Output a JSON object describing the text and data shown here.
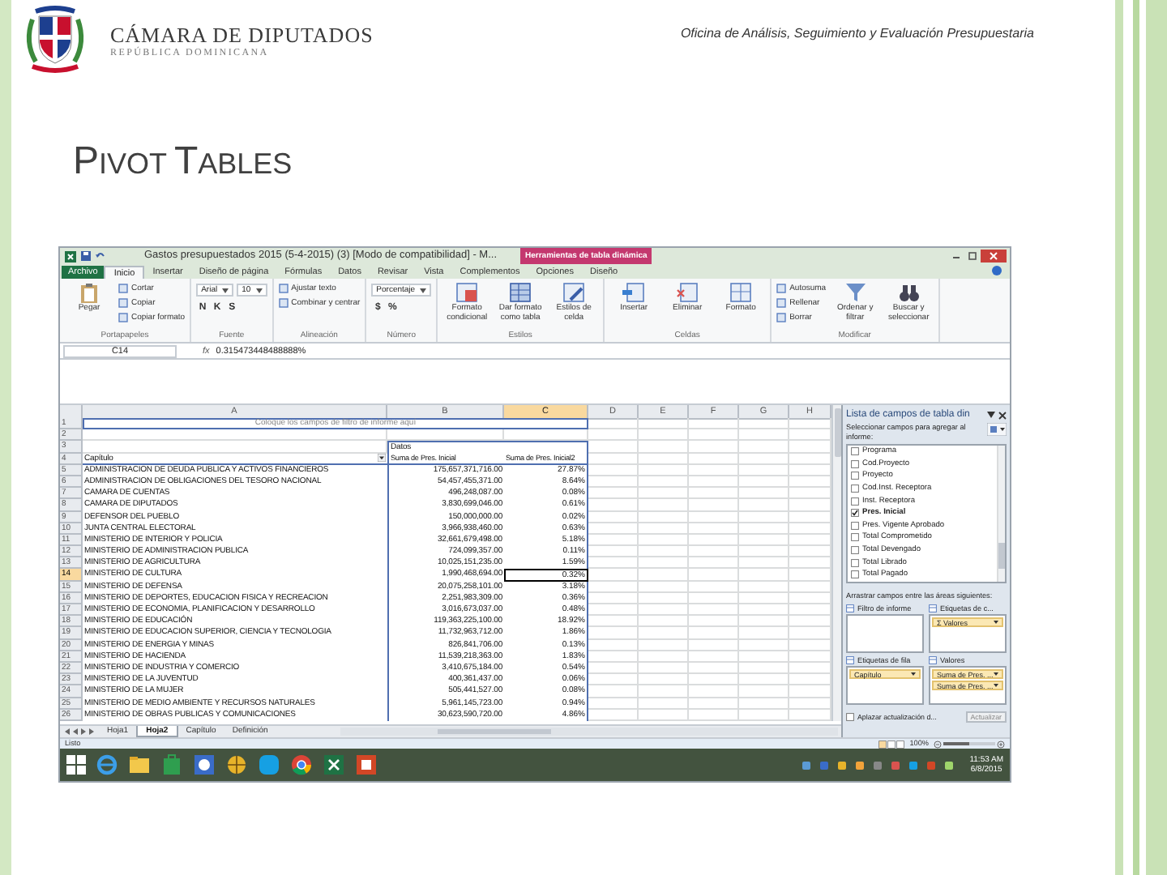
{
  "header": {
    "org_name": "CÁMARA DE DIPUTADOS",
    "org_subtitle": "REPÚBLICA DOMINICANA",
    "office": "Oficina de Análisis, Seguimiento y Evaluación Presupuestaria"
  },
  "title": "PIVOT TABLES",
  "excel": {
    "window_title": "Gastos presupuestados 2015 (5-4-2015) (3)  [Modo de compatibilidad] - M...",
    "contextual_group": "Herramientas de tabla dinámica",
    "ribbon_tabs": [
      {
        "label": "Archivo",
        "kind": "file",
        "selected": false
      },
      {
        "label": "Inicio",
        "kind": "tab",
        "selected": true
      },
      {
        "label": "Insertar",
        "kind": "tab",
        "selected": false
      },
      {
        "label": "Diseño de página",
        "kind": "tab",
        "selected": false
      },
      {
        "label": "Fórmulas",
        "kind": "tab",
        "selected": false
      },
      {
        "label": "Datos",
        "kind": "tab",
        "selected": false
      },
      {
        "label": "Revisar",
        "kind": "tab",
        "selected": false
      },
      {
        "label": "Vista",
        "kind": "tab",
        "selected": false
      },
      {
        "label": "Complementos",
        "kind": "tab",
        "selected": false
      },
      {
        "label": "Opciones",
        "kind": "tab",
        "selected": false
      },
      {
        "label": "Diseño",
        "kind": "tab",
        "selected": false
      }
    ],
    "ribbon_groups": [
      {
        "label": "Portapapeles",
        "items": [
          {
            "kind": "large",
            "label": "Pegar"
          },
          {
            "kind": "small",
            "label": "Cortar"
          },
          {
            "kind": "small",
            "label": "Copiar"
          },
          {
            "kind": "small",
            "label": "Copiar formato"
          }
        ]
      },
      {
        "label": "Fuente",
        "items": [
          {
            "kind": "field",
            "label": "Arial"
          },
          {
            "kind": "field",
            "label": "10"
          },
          {
            "kind": "glyph",
            "label": "N"
          },
          {
            "kind": "glyph",
            "label": "K"
          },
          {
            "kind": "glyph",
            "label": "S"
          }
        ]
      },
      {
        "label": "Alineación",
        "items": [
          {
            "kind": "small",
            "label": "Ajustar texto"
          },
          {
            "kind": "small",
            "label": "Combinar y centrar"
          }
        ]
      },
      {
        "label": "Número",
        "items": [
          {
            "kind": "field",
            "label": "Porcentaje"
          },
          {
            "kind": "glyph",
            "label": "$"
          },
          {
            "kind": "glyph",
            "label": "%"
          }
        ]
      },
      {
        "label": "Estilos",
        "items": [
          {
            "kind": "large",
            "label": "Formato condicional"
          },
          {
            "kind": "large",
            "label": "Dar formato como tabla"
          },
          {
            "kind": "large",
            "label": "Estilos de celda"
          }
        ]
      },
      {
        "label": "Celdas",
        "items": [
          {
            "kind": "large",
            "label": "Insertar"
          },
          {
            "kind": "large",
            "label": "Eliminar"
          },
          {
            "kind": "large",
            "label": "Formato"
          }
        ]
      },
      {
        "label": "Modificar",
        "items": [
          {
            "kind": "small",
            "label": "Autosuma"
          },
          {
            "kind": "small",
            "label": "Rellenar"
          },
          {
            "kind": "small",
            "label": "Borrar"
          },
          {
            "kind": "large",
            "label": "Ordenar y filtrar"
          },
          {
            "kind": "large",
            "label": "Buscar y seleccionar"
          }
        ]
      }
    ],
    "name_box": "C14",
    "function_label": "fx",
    "formula": "0.315473448488888%",
    "columns": [
      {
        "label": "A",
        "selected": false
      },
      {
        "label": "B",
        "selected": false
      },
      {
        "label": "C",
        "selected": true
      },
      {
        "label": "D",
        "selected": false
      },
      {
        "label": "E",
        "selected": false
      },
      {
        "label": "F",
        "selected": false
      },
      {
        "label": "G",
        "selected": false
      },
      {
        "label": "H",
        "selected": false
      }
    ],
    "rows": [
      {
        "number": "1",
        "kind": "filter",
        "text": "Coloque los campos de filtro de informe aquí",
        "selected": false
      },
      {
        "number": "2",
        "kind": "blank",
        "selected": false
      },
      {
        "number": "3",
        "kind": "caption",
        "text": "Datos",
        "selected": false
      },
      {
        "number": "4",
        "kind": "header",
        "label": "Capítulo",
        "values": [
          "Suma de Pres. Inicial",
          "Suma de Pres. Inicial2"
        ],
        "selected": false
      },
      {
        "number": "5",
        "kind": "data",
        "label": "ADMINISTRACION DE DEUDA PUBLICA Y ACTIVOS FINANCIEROS",
        "amount": "175,657,371,716.00",
        "share": "27.87%",
        "selected": false
      },
      {
        "number": "6",
        "kind": "data",
        "label": "ADMINISTRACION DE OBLIGACIONES DEL TESORO NACIONAL",
        "amount": "54,457,455,371.00",
        "share": "8.64%",
        "selected": false
      },
      {
        "number": "7",
        "kind": "data",
        "label": "CAMARA DE CUENTAS",
        "amount": "496,248,087.00",
        "share": "0.08%",
        "selected": false
      },
      {
        "number": "8",
        "kind": "data",
        "label": "CAMARA DE DIPUTADOS",
        "amount": "3,830,699,046.00",
        "share": "0.61%",
        "selected": false
      },
      {
        "number": "9",
        "kind": "data",
        "label": "DEFENSOR DEL PUEBLO",
        "amount": "150,000,000.00",
        "share": "0.02%",
        "selected": false
      },
      {
        "number": "10",
        "kind": "data",
        "label": "JUNTA CENTRAL ELECTORAL",
        "amount": "3,966,938,460.00",
        "share": "0.63%",
        "selected": false
      },
      {
        "number": "11",
        "kind": "data",
        "label": "MINISTERIO DE INTERIOR Y POLICIA",
        "amount": "32,661,679,498.00",
        "share": "5.18%",
        "selected": false
      },
      {
        "number": "12",
        "kind": "data",
        "label": "MINISTERIO DE ADMINISTRACION PUBLICA",
        "amount": "724,099,357.00",
        "share": "0.11%",
        "selected": false
      },
      {
        "number": "13",
        "kind": "data",
        "label": "MINISTERIO DE AGRICULTURA",
        "amount": "10,025,151,235.00",
        "share": "1.59%",
        "selected": false
      },
      {
        "number": "14",
        "kind": "data",
        "label": "MINISTERIO DE CULTURA",
        "amount": "1,990,468,694.00",
        "share": "0.32%",
        "selected": true
      },
      {
        "number": "15",
        "kind": "data",
        "label": "MINISTERIO DE DEFENSA",
        "amount": "20,075,258,101.00",
        "share": "3.18%",
        "selected": false
      },
      {
        "number": "16",
        "kind": "data",
        "label": "MINISTERIO DE DEPORTES, EDUCACION FISICA Y RECREACION",
        "amount": "2,251,983,309.00",
        "share": "0.36%",
        "selected": false
      },
      {
        "number": "17",
        "kind": "data",
        "label": "MINISTERIO DE ECONOMIA, PLANIFICACION Y DESARROLLO",
        "amount": "3,016,673,037.00",
        "share": "0.48%",
        "selected": false
      },
      {
        "number": "18",
        "kind": "data",
        "label": "MINISTERIO DE EDUCACIÓN",
        "amount": "119,363,225,100.00",
        "share": "18.92%",
        "selected": false
      },
      {
        "number": "19",
        "kind": "data",
        "label": "MINISTERIO DE EDUCACION SUPERIOR, CIENCIA Y TECNOLOGIA",
        "amount": "11,732,963,712.00",
        "share": "1.86%",
        "selected": false
      },
      {
        "number": "20",
        "kind": "data",
        "label": "MINISTERIO DE ENERGIA Y MINAS",
        "amount": "826,841,706.00",
        "share": "0.13%",
        "selected": false
      },
      {
        "number": "21",
        "kind": "data",
        "label": "MINISTERIO DE HACIENDA",
        "amount": "11,539,218,363.00",
        "share": "1.83%",
        "selected": false
      },
      {
        "number": "22",
        "kind": "data",
        "label": "MINISTERIO DE INDUSTRIA Y COMERCIO",
        "amount": "3,410,675,184.00",
        "share": "0.54%",
        "selected": false
      },
      {
        "number": "23",
        "kind": "data",
        "label": "MINISTERIO DE LA JUVENTUD",
        "amount": "400,361,437.00",
        "share": "0.06%",
        "selected": false
      },
      {
        "number": "24",
        "kind": "data",
        "label": "MINISTERIO DE LA MUJER",
        "amount": "505,441,527.00",
        "share": "0.08%",
        "selected": false
      },
      {
        "number": "25",
        "kind": "data",
        "label": "MINISTERIO DE MEDIO AMBIENTE Y RECURSOS NATURALES",
        "amount": "5,961,145,723.00",
        "share": "0.94%",
        "selected": false
      },
      {
        "number": "26",
        "kind": "data",
        "label": "MINISTERIO DE OBRAS PUBLICAS Y COMUNICACIONES",
        "amount": "30,623,590,720.00",
        "share": "4.86%",
        "selected": false
      }
    ],
    "sheet_tabs": [
      {
        "label": "Hoja1",
        "selected": false
      },
      {
        "label": "Hoja2",
        "selected": true
      },
      {
        "label": "Capítulo",
        "selected": false
      },
      {
        "label": "Definición",
        "selected": false
      }
    ],
    "status": "Listo",
    "zoom": "100%",
    "zoom_slider": {
      "level": 0.5
    }
  },
  "field_list": {
    "title": "Lista de campos de tabla din",
    "instruction": "Seleccionar campos para agregar al informe:",
    "fields": [
      {
        "label": "Programa",
        "checked": false
      },
      {
        "label": "Cod.Proyecto",
        "checked": false
      },
      {
        "label": "Proyecto",
        "checked": false
      },
      {
        "label": "Cod.Inst. Receptora",
        "checked": false
      },
      {
        "label": "Inst. Receptora",
        "checked": false
      },
      {
        "label": "Pres. Inicial",
        "checked": true
      },
      {
        "label": "Pres. Vigente Aprobado",
        "checked": false
      },
      {
        "label": "Total Comprometido",
        "checked": false
      },
      {
        "label": "Total Devengado",
        "checked": false
      },
      {
        "label": "Total Librado",
        "checked": false
      },
      {
        "label": "Total Pagado",
        "checked": false
      }
    ],
    "drag_instruction": "Arrastrar campos entre las áreas siguientes:",
    "areas": [
      {
        "label": "Filtro de informe"
      },
      {
        "label": "Etiquetas de c...",
        "items": [
          "Σ Valores"
        ]
      },
      {
        "label": "Etiquetas de fila",
        "items": [
          "Capítulo"
        ]
      },
      {
        "label": "Valores",
        "items": [
          "Suma de Pres. ...",
          "Suma de Pres. ..."
        ]
      }
    ],
    "defer_label": "Aplazar actualización d...",
    "defer_checked": false,
    "update_label": "Actualizar"
  },
  "taskbar": {
    "time": "11:53 AM",
    "date": "6/8/2015"
  }
}
